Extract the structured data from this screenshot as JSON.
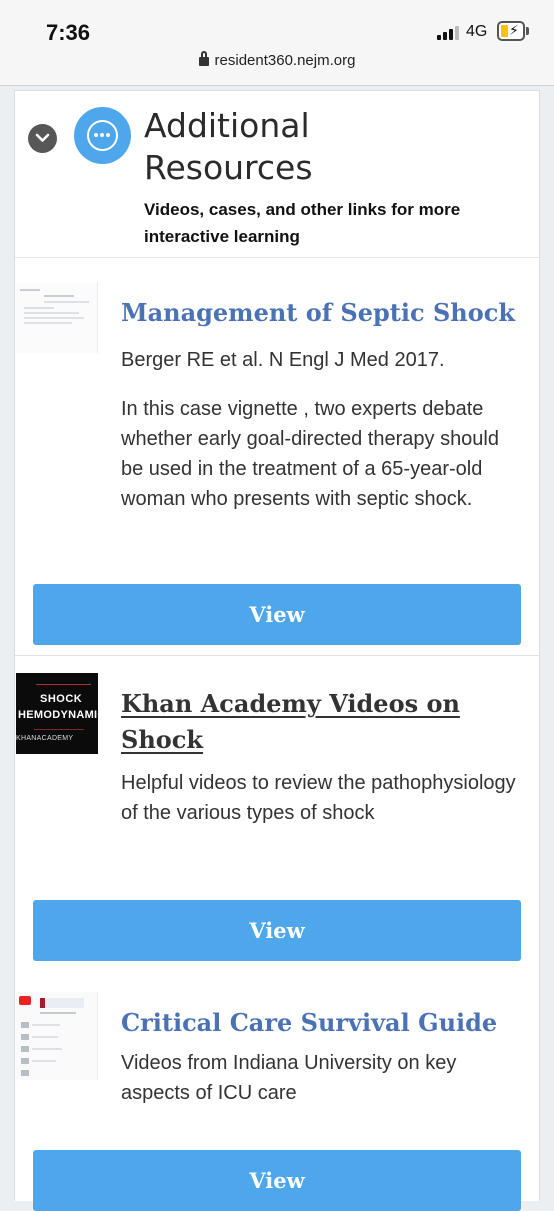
{
  "status_bar": {
    "time": "7:36",
    "network": "4G",
    "battery_icon": "charging-battery-icon"
  },
  "url_bar": {
    "url": "resident360.nejm.org"
  },
  "section": {
    "title": "Additional Resources",
    "subtitle": "Videos, cases, and other links for more interactive learning",
    "icon": "more-options-icon",
    "toggle_icon": "chevron-down-icon",
    "accent_color": "#4da7ea"
  },
  "resources": [
    {
      "title": "Management of Septic Shock",
      "meta": "Berger RE et al. N Engl J Med 2017.",
      "description": "In this case vignette , two experts debate whether early goal-directed therapy should be used in the treatment of a 65-year-old woman who presents with septic shock.",
      "button": "View"
    },
    {
      "title": "Khan Academy Videos on Shock",
      "thumbnail_text": [
        "SHOCK",
        "HEMODYNAMICS",
        "KHANACADEMY"
      ],
      "description": "Helpful videos to review the pathophysiology of the various types of shock",
      "button": "View"
    },
    {
      "title": "Critical Care Survival Guide",
      "description": "Videos from Indiana University on key aspects of ICU care",
      "button": "View"
    }
  ],
  "colors": {
    "title_blue": "#4a72b5",
    "button_blue": "#4ea7ea"
  }
}
